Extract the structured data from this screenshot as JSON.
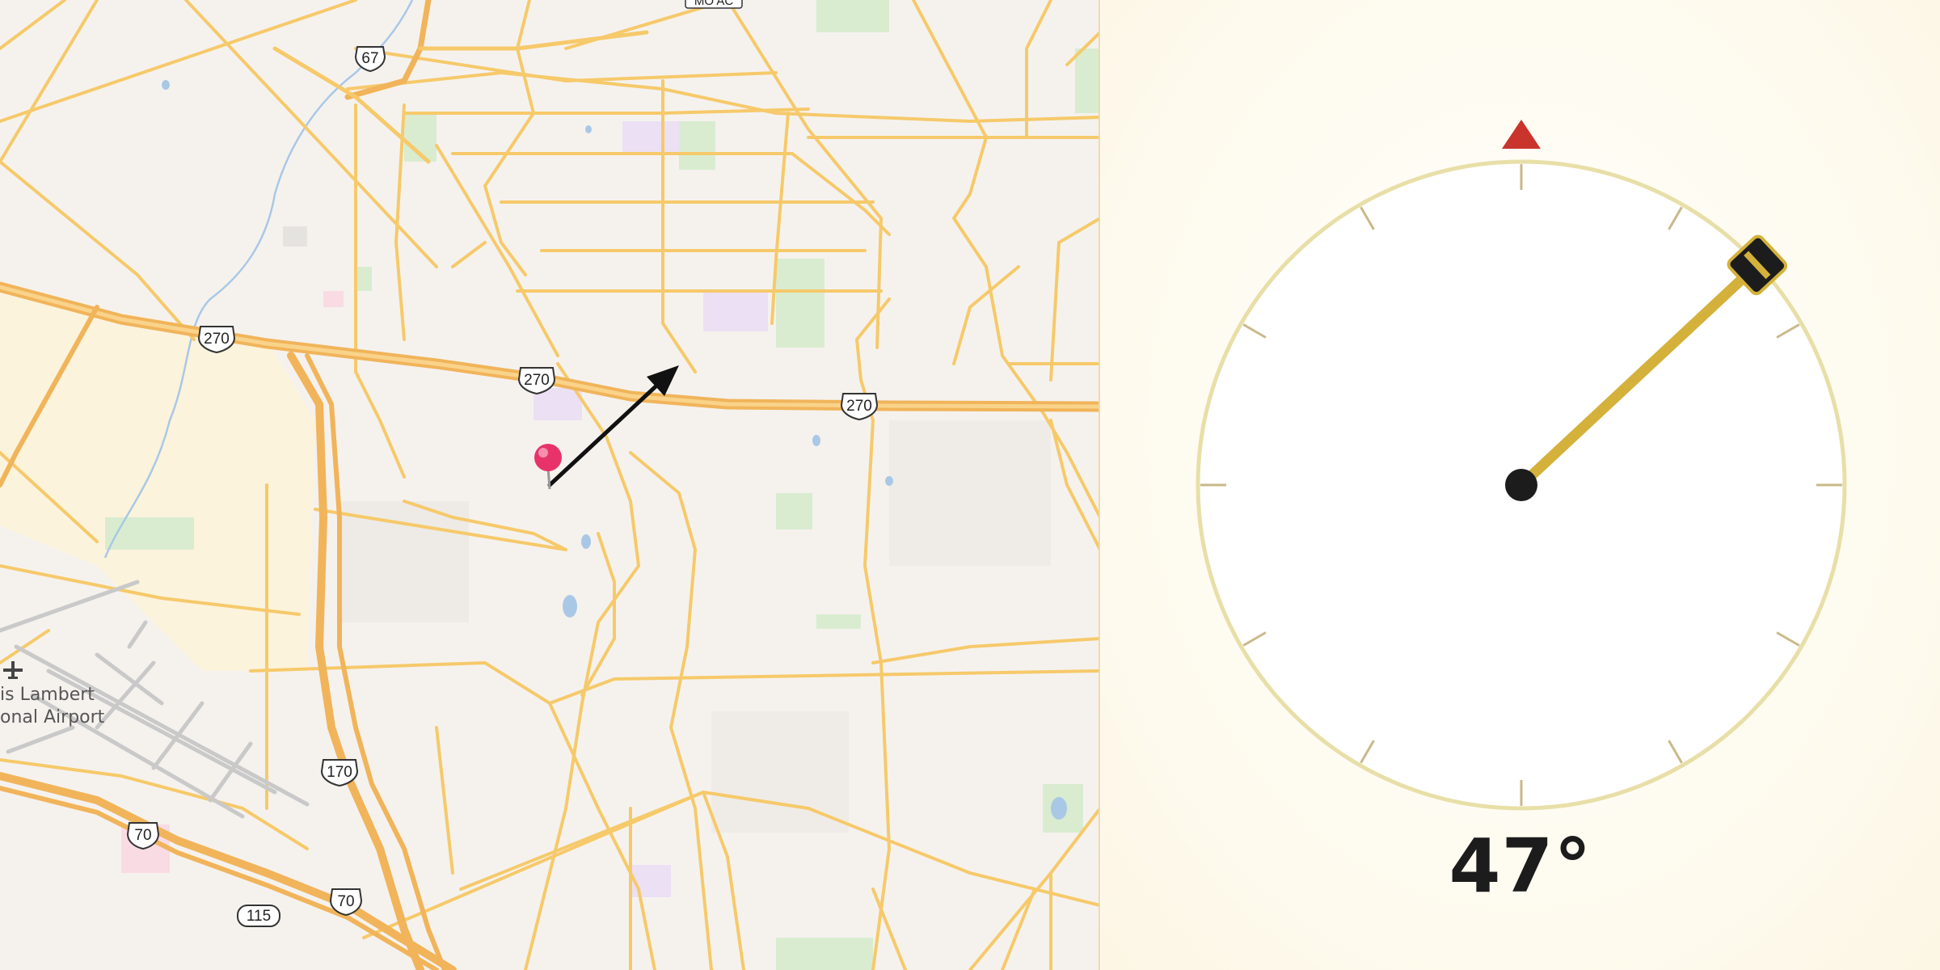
{
  "map": {
    "labels": {
      "airport_line1": "is Lambert",
      "airport_line2": "onal Airport",
      "top_edge": "MO AC"
    },
    "shields": {
      "us67": "67",
      "i270_a": "270",
      "i270_b": "270",
      "i270_c": "270",
      "i170": "170",
      "i70_a": "70",
      "i70_b": "70",
      "route115": "115"
    },
    "pin_color": "#e8336a",
    "road_color": "#f6c96a",
    "highway_color": "#f1b45a"
  },
  "compass": {
    "bearing_degrees": 47,
    "bearing_label": "47°",
    "north_marker_color": "#c9352c",
    "dial_ring_color": "#e8dfa8",
    "needle_color": "#d4b13a"
  }
}
